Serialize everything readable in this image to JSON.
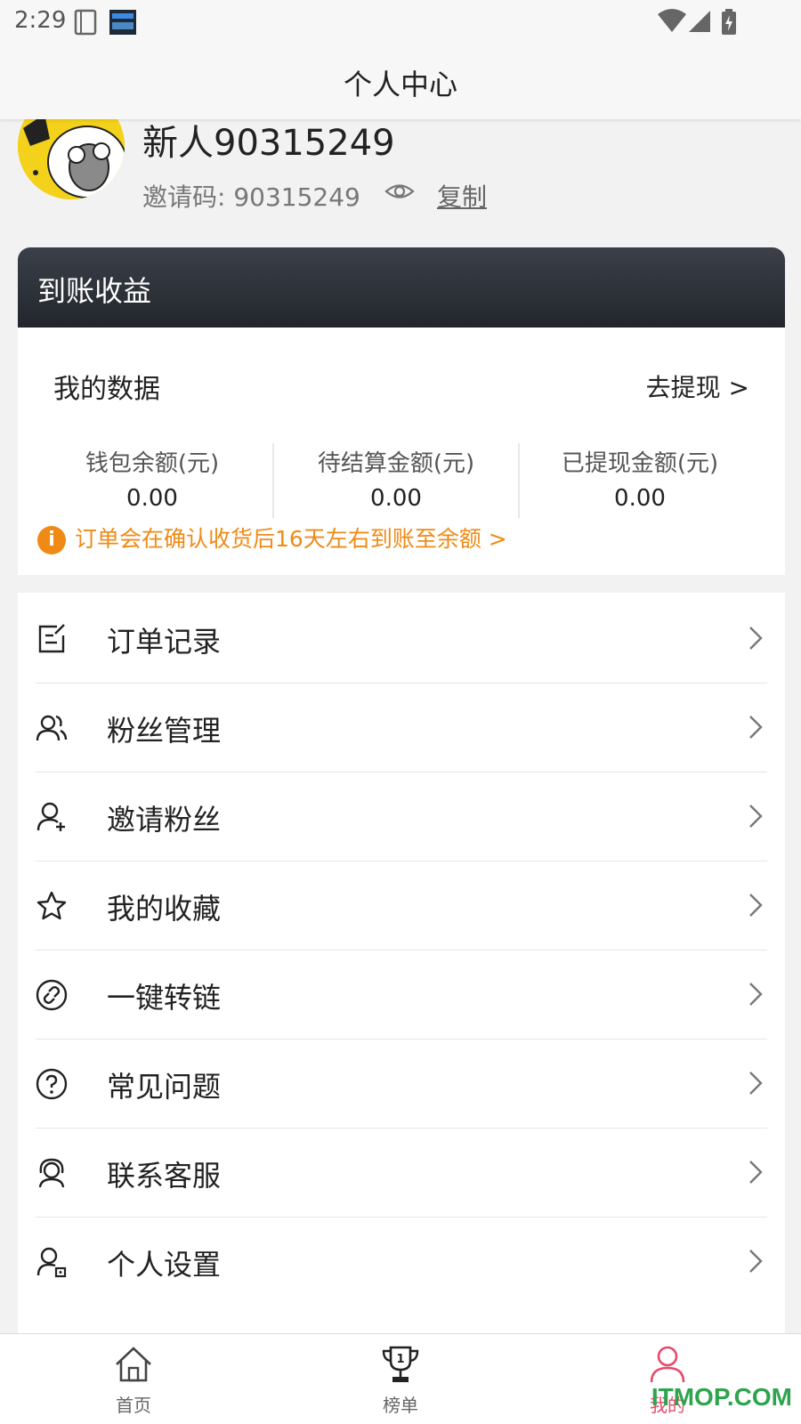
{
  "status_bar": {
    "time": "2:29"
  },
  "header": {
    "title": "个人中心"
  },
  "profile": {
    "username": "新人90315249",
    "invite_label": "邀请码: 90315249",
    "copy_label": "复制"
  },
  "earnings": {
    "card_title": "到账收益",
    "my_data_label": "我的数据",
    "withdraw_link": "去提现 >",
    "stats": [
      {
        "label": "钱包余额(元)",
        "value": "0.00"
      },
      {
        "label": "待结算金额(元)",
        "value": "0.00"
      },
      {
        "label": "已提现金额(元)",
        "value": "0.00"
      }
    ],
    "notice": "订单会在确认收货后16天左右到账至余额 >",
    "notice_color": "#f08a16"
  },
  "menu": {
    "items": [
      {
        "label": "订单记录",
        "icon": "order-record-icon"
      },
      {
        "label": "粉丝管理",
        "icon": "fans-icon"
      },
      {
        "label": "邀请粉丝",
        "icon": "invite-user-icon"
      },
      {
        "label": "我的收藏",
        "icon": "star-icon"
      },
      {
        "label": "一键转链",
        "icon": "link-icon"
      },
      {
        "label": "常见问题",
        "icon": "question-icon"
      },
      {
        "label": "联系客服",
        "icon": "customer-service-icon"
      },
      {
        "label": "个人设置",
        "icon": "user-settings-icon"
      }
    ]
  },
  "bottom_nav": {
    "tabs": [
      {
        "label": "首页",
        "icon": "home-icon"
      },
      {
        "label": "榜单",
        "icon": "trophy-icon"
      },
      {
        "label": "我的",
        "icon": "profile-icon",
        "active": true
      }
    ],
    "active_color": "#e84a6a"
  },
  "watermark": "ITMOP.COM"
}
